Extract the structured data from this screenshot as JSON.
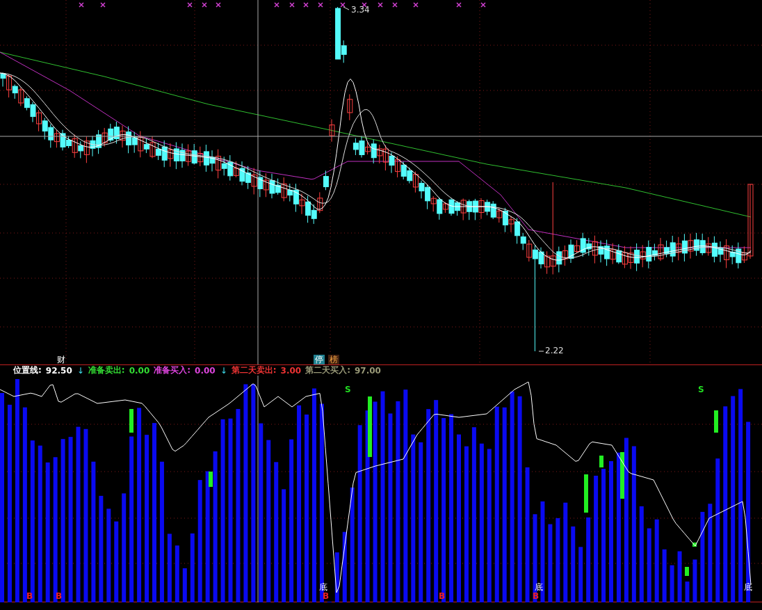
{
  "price_panel": {
    "high_label": "3.34",
    "low_label": "2.22",
    "tags": [
      {
        "text": "财",
        "kind": "finance"
      },
      {
        "text": "停",
        "kind": "halt"
      },
      {
        "text": "榜",
        "kind": "rank"
      }
    ]
  },
  "indicator_legend": [
    {
      "label": "位置线:",
      "value": "92.50",
      "color": "#ffffff",
      "arrow": "↓"
    },
    {
      "label": "准备卖出:",
      "value": "0.00",
      "color": "#33dd33"
    },
    {
      "label": "准备买入:",
      "value": "0.00",
      "color": "#dd44dd",
      "arrow": "↓"
    },
    {
      "label": "第二天卖出:",
      "value": "3.00",
      "color": "#ee3333"
    },
    {
      "label": "第二天买入:",
      "value": "97.00",
      "color": "#999977"
    }
  ],
  "indicator_panel": {
    "signals": [
      {
        "text": "S",
        "kind": "sell"
      },
      {
        "text": "S",
        "kind": "sell"
      },
      {
        "text": "底",
        "kind": "bottom"
      },
      {
        "text": "底",
        "kind": "bottom"
      },
      {
        "text": "底",
        "kind": "bottom"
      },
      {
        "text": "B",
        "kind": "buy"
      },
      {
        "text": "B",
        "kind": "buy"
      },
      {
        "text": "B",
        "kind": "buy"
      },
      {
        "text": "B",
        "kind": "buy"
      },
      {
        "text": "B",
        "kind": "buy"
      }
    ]
  }
}
